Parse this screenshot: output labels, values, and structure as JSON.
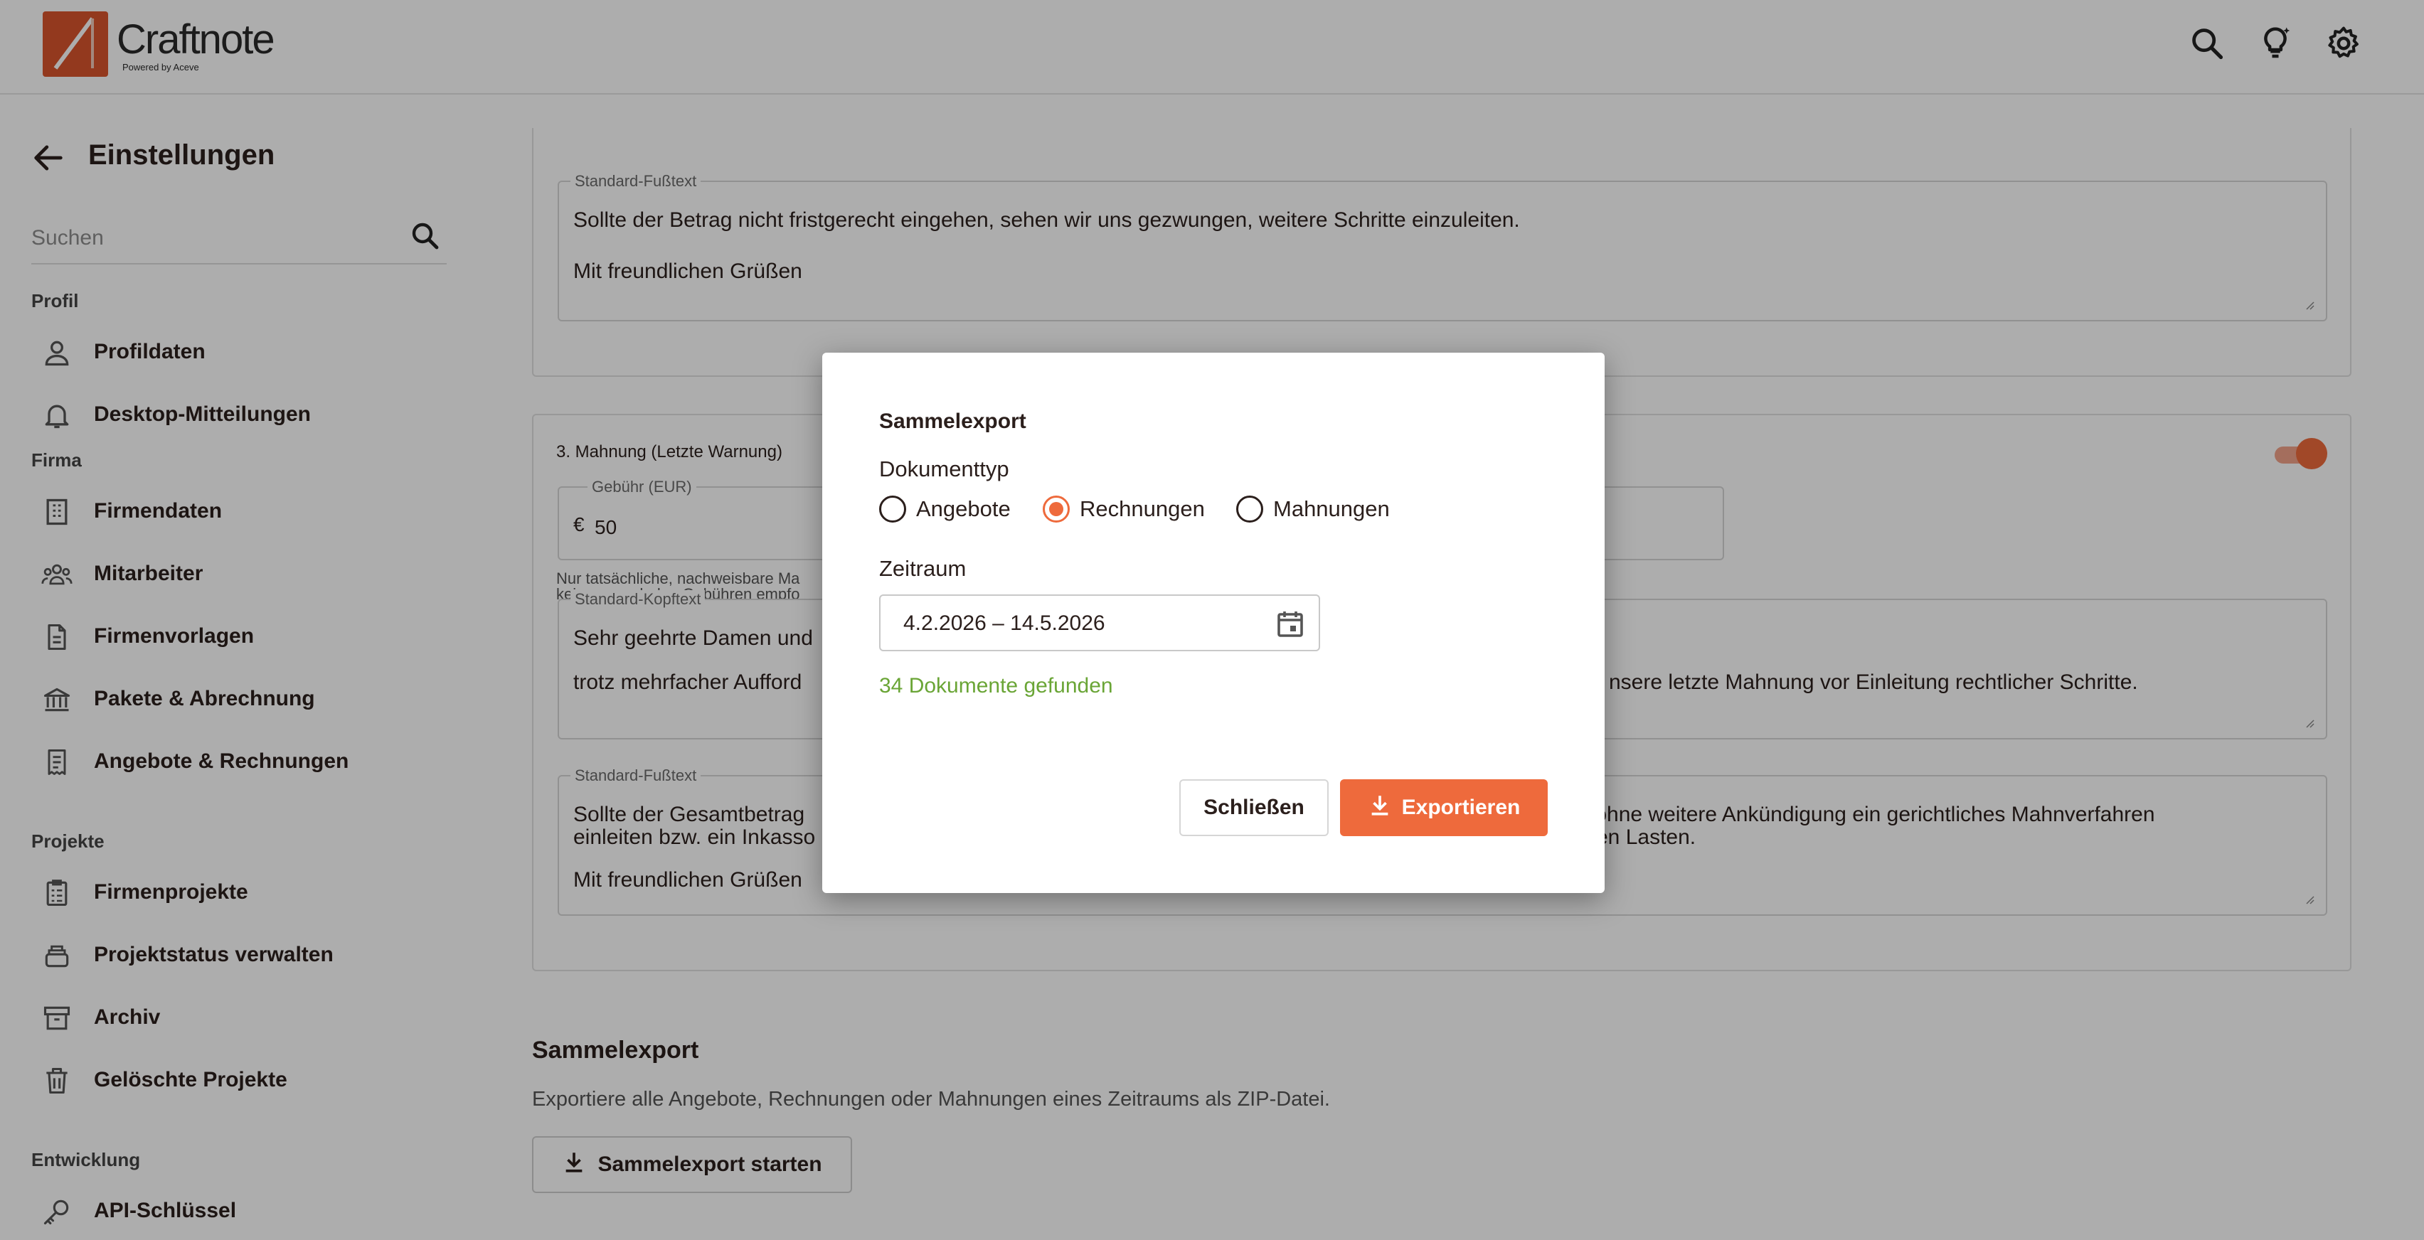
{
  "header": {
    "app_name": "Craftnote",
    "tagline": "Powered by Aceve",
    "icons": [
      "search-icon",
      "lightbulb-icon",
      "gear-icon"
    ]
  },
  "sidebar": {
    "title": "Einstellungen",
    "search_placeholder": "Suchen",
    "sections": {
      "profil": "Profil",
      "firma": "Firma",
      "projekte": "Projekte",
      "entwicklung": "Entwicklung"
    },
    "items": [
      {
        "label": "Profildaten",
        "icon": "person-icon"
      },
      {
        "label": "Desktop-Mitteilungen",
        "icon": "bell-icon"
      },
      {
        "label": "Firmendaten",
        "icon": "building-icon"
      },
      {
        "label": "Mitarbeiter",
        "icon": "group-icon"
      },
      {
        "label": "Firmenvorlagen",
        "icon": "document-icon"
      },
      {
        "label": "Pakete & Abrechnung",
        "icon": "bank-icon"
      },
      {
        "label": "Angebote & Rechnungen",
        "icon": "receipt-icon"
      },
      {
        "label": "Firmenprojekte",
        "icon": "clipboard-icon"
      },
      {
        "label": "Projektstatus verwalten",
        "icon": "layers-icon"
      },
      {
        "label": "Archiv",
        "icon": "archive-icon"
      },
      {
        "label": "Gelöschte Projekte",
        "icon": "trash-icon"
      },
      {
        "label": "API-Schlüssel",
        "icon": "key-icon"
      }
    ]
  },
  "main": {
    "card1": {
      "footer_legend": "Standard-Fußtext",
      "footer_text": "Sollte der Betrag nicht fristgerecht eingehen, sehen wir uns gezwungen, weitere Schritte einzuleiten.\n\nMit freundlichen Grüßen"
    },
    "card2": {
      "title": "3. Mahnung (Letzte Warnung)",
      "toggle_on": true,
      "fee_legend": "Gebühr (EUR)",
      "fee_currency": "€",
      "fee_value": "50",
      "hint_line1": "Nur tatsächliche, nachweisbare Ma",
      "hint_line2": "keine pauschalen Gebühren empfo",
      "header_legend": "Standard-Kopftext",
      "header_text_left_l1": "Sehr geehrte Damen und",
      "header_text_left_l2": "trotz mehrfacher Aufford",
      "header_text_right": "nsere letzte Mahnung vor Einleitung rechtlicher Schritte.",
      "footer_legend": "Standard-Fußtext",
      "footer_left_l1": "Sollte der Gesamtbetrag",
      "footer_left_l2": "einleiten bzw. ein Inkasso",
      "footer_left_l3": "Mit freundlichen Grüßen",
      "footer_right_l1": "r ohne weitere Ankündigung ein gerichtliches Mahnverfahren",
      "footer_right_l2": "ren Lasten."
    },
    "bulk": {
      "title": "Sammelexport",
      "description": "Exportiere alle Angebote, Rechnungen oder Mahnungen eines Zeitraums als ZIP-Datei.",
      "button": "Sammelexport starten"
    }
  },
  "modal": {
    "title": "Sammelexport",
    "doctype_label": "Dokumenttyp",
    "options": [
      "Angebote",
      "Rechnungen",
      "Mahnungen"
    ],
    "selected": "Rechnungen",
    "period_label": "Zeitraum",
    "period_value": "4.2.2026 – 14.5.2026",
    "found_text": "34 Dokumente gefunden",
    "close_label": "Schließen",
    "export_label": "Exportieren",
    "accent_color": "#ee6a3c",
    "success_color": "#6aa536"
  }
}
